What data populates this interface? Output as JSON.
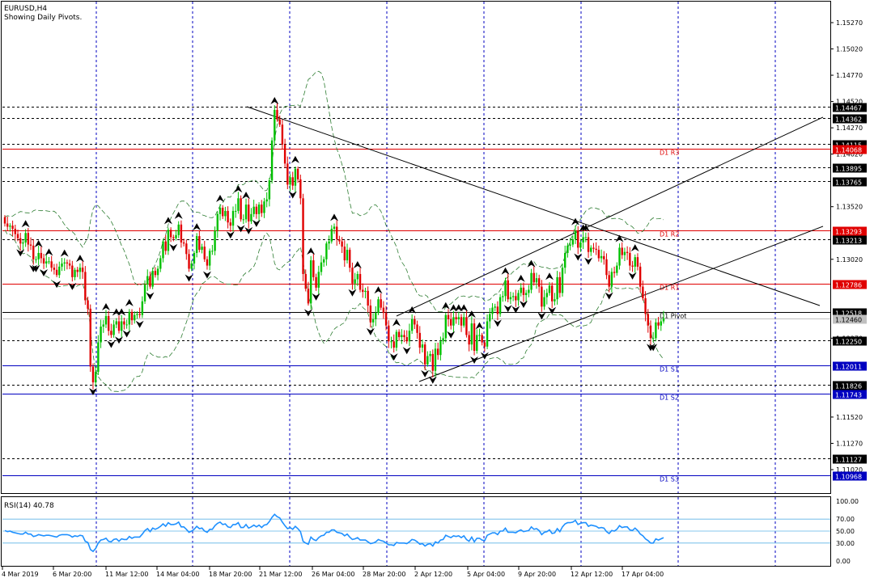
{
  "header": {
    "symbol_line": "EURUSD,H4",
    "subtitle": "Showing Daily Pivots."
  },
  "price_axis": {
    "ticks": [
      "1.15270",
      "1.15020",
      "1.14770",
      "1.14520",
      "1.14270",
      "1.14020",
      "1.13520",
      "1.13020",
      "1.12270",
      "1.11520",
      "1.11270",
      "1.11020"
    ]
  },
  "levels": [
    {
      "price": "1.14467",
      "style": "dash",
      "label": ""
    },
    {
      "price": "1.14362",
      "style": "dash",
      "label": ""
    },
    {
      "price": "1.14115",
      "style": "dash",
      "label": ""
    },
    {
      "price": "1.14068",
      "style": "red",
      "label": "D1 R3"
    },
    {
      "price": "1.13895",
      "style": "dash",
      "label": ""
    },
    {
      "price": "1.13765",
      "style": "dash",
      "label": ""
    },
    {
      "price": "1.13293",
      "style": "red",
      "label": "D1 R2"
    },
    {
      "price": "1.13213",
      "style": "dash",
      "label": ""
    },
    {
      "price": "1.12786",
      "style": "red",
      "label": "D1 R1"
    },
    {
      "price": "1.12518",
      "style": "black",
      "label": "D1 Pivot"
    },
    {
      "price": "1.12250",
      "style": "dash",
      "label": ""
    },
    {
      "price": "1.12011",
      "style": "blue",
      "label": "D1 S1"
    },
    {
      "price": "1.11826",
      "style": "dash",
      "label": ""
    },
    {
      "price": "1.11743",
      "style": "blue",
      "label": "D1 S2"
    },
    {
      "price": "1.11127",
      "style": "dash",
      "label": ""
    },
    {
      "price": "1.10968",
      "style": "blue",
      "label": "D1 S3"
    }
  ],
  "current_price": "1.12460",
  "rsi": {
    "label": "RSI(14) 40.78",
    "ticks": [
      "100.00",
      "70.00",
      "50.00",
      "30.00",
      "0.00"
    ]
  },
  "time_axis": [
    "4 Mar 2019",
    "6 Mar 20:00",
    "11 Mar 12:00",
    "14 Mar 04:00",
    "18 Mar 20:00",
    "21 Mar 12:00",
    "26 Mar 04:00",
    "28 Mar 20:00",
    "2 Apr 12:00",
    "5 Apr 04:00",
    "9 Apr 20:00",
    "12 Apr 12:00",
    "17 Apr 04:00"
  ],
  "colors": {
    "bull": "#00c000",
    "bear": "#e00000",
    "grid": "#0000c0",
    "pivot_red": "#e00000",
    "pivot_blue": "#0000c0",
    "rsi_line": "#1e90ff",
    "band": "#2e7d32",
    "bg": "#ffffff"
  },
  "chart_data": {
    "type": "candlestick",
    "xlabel": "",
    "ylabel": "",
    "ylim": [
      1.1087,
      1.1543
    ],
    "closes": [
      1.1336,
      1.1333,
      1.1334,
      1.1331,
      1.1326,
      1.1322,
      1.1317,
      1.1318,
      1.1327,
      1.1316,
      1.1315,
      1.1302,
      1.1302,
      1.1308,
      1.1303,
      1.1298,
      1.13,
      1.13,
      1.1294,
      1.1292,
      1.1287,
      1.1295,
      1.1298,
      1.1299,
      1.1298,
      1.1296,
      1.1285,
      1.1292,
      1.129,
      1.1294,
      1.129,
      1.1263,
      1.1255,
      1.12,
      1.1185,
      1.1195,
      1.1223,
      1.1238,
      1.124,
      1.1248,
      1.1234,
      1.123,
      1.124,
      1.1243,
      1.1234,
      1.1243,
      1.124,
      1.124,
      1.1252,
      1.1244,
      1.1249,
      1.125,
      1.1249,
      1.1262,
      1.1278,
      1.1286,
      1.1276,
      1.1291,
      1.1287,
      1.1293,
      1.1303,
      1.1319,
      1.131,
      1.133,
      1.1323,
      1.1322,
      1.1325,
      1.1335,
      1.1318,
      1.1317,
      1.1307,
      1.1293,
      1.1298,
      1.1308,
      1.1324,
      1.1311,
      1.1314,
      1.1302,
      1.1296,
      1.131,
      1.131,
      1.1329,
      1.1345,
      1.1351,
      1.1343,
      1.1348,
      1.1337,
      1.1334,
      1.1348,
      1.1348,
      1.136,
      1.134,
      1.134,
      1.1354,
      1.1338,
      1.1345,
      1.1352,
      1.1345,
      1.1354,
      1.1346,
      1.1357,
      1.1359,
      1.1377,
      1.1415,
      1.1444,
      1.1435,
      1.143,
      1.1411,
      1.1393,
      1.1373,
      1.138,
      1.1372,
      1.1388,
      1.1378,
      1.136,
      1.1288,
      1.1274,
      1.126,
      1.1301,
      1.1285,
      1.1275,
      1.129,
      1.1299,
      1.1302,
      1.1317,
      1.1319,
      1.1331,
      1.1333,
      1.1321,
      1.1319,
      1.1314,
      1.1301,
      1.1311,
      1.1294,
      1.1279,
      1.1283,
      1.1288,
      1.1273,
      1.1271,
      1.1272,
      1.1258,
      1.1242,
      1.1245,
      1.1251,
      1.1264,
      1.1256,
      1.1251,
      1.1239,
      1.1224,
      1.1224,
      1.1218,
      1.1233,
      1.1228,
      1.123,
      1.1228,
      1.1224,
      1.1234,
      1.1245,
      1.124,
      1.1232,
      1.1218,
      1.1221,
      1.1202,
      1.121,
      1.1212,
      1.1196,
      1.1217,
      1.1211,
      1.1224,
      1.1227,
      1.1249,
      1.1245,
      1.1239,
      1.1247,
      1.1245,
      1.1247,
      1.1239,
      1.1247,
      1.123,
      1.1221,
      1.1241,
      1.1215,
      1.123,
      1.123,
      1.1223,
      1.1219,
      1.1243,
      1.125,
      1.1256,
      1.1257,
      1.125,
      1.1266,
      1.1267,
      1.1282,
      1.1264,
      1.1266,
      1.1267,
      1.1263,
      1.127,
      1.1275,
      1.1268,
      1.127,
      1.1273,
      1.1289,
      1.128,
      1.1284,
      1.1276,
      1.1257,
      1.1266,
      1.127,
      1.1277,
      1.1262,
      1.1264,
      1.1285,
      1.127,
      1.1294,
      1.1308,
      1.1315,
      1.1316,
      1.1321,
      1.1329,
      1.1313,
      1.1318,
      1.1323,
      1.1323,
      1.1309,
      1.1313,
      1.1312,
      1.1311,
      1.1303,
      1.1305,
      1.1302,
      1.1287,
      1.1276,
      1.129,
      1.1289,
      1.1296,
      1.1313,
      1.1306,
      1.1309,
      1.1308,
      1.1296,
      1.1295,
      1.1304,
      1.1295,
      1.1276,
      1.1265,
      1.125,
      1.1239,
      1.1227,
      1.1227,
      1.1242,
      1.1239,
      1.1243,
      1.1246
    ],
    "rsi_values": [
      51,
      49,
      50,
      48,
      47,
      46,
      45,
      45,
      48,
      45,
      45,
      41,
      42,
      44,
      43,
      42,
      43,
      43,
      42,
      41,
      40,
      43,
      44,
      44,
      44,
      43,
      40,
      42,
      41,
      43,
      42,
      33,
      31,
      19,
      16,
      21,
      30,
      35,
      36,
      38,
      33,
      32,
      36,
      37,
      33,
      37,
      36,
      36,
      41,
      38,
      40,
      40,
      40,
      45,
      51,
      54,
      49,
      55,
      53,
      55,
      58,
      62,
      58,
      64,
      61,
      61,
      62,
      65,
      57,
      57,
      53,
      48,
      50,
      53,
      58,
      54,
      55,
      50,
      48,
      53,
      53,
      59,
      63,
      65,
      61,
      62,
      57,
      56,
      61,
      61,
      64,
      56,
      56,
      61,
      55,
      57,
      60,
      57,
      60,
      56,
      60,
      61,
      66,
      73,
      78,
      74,
      72,
      65,
      59,
      54,
      56,
      53,
      58,
      54,
      49,
      33,
      30,
      28,
      40,
      36,
      34,
      39,
      42,
      43,
      48,
      48,
      52,
      52,
      48,
      47,
      46,
      42,
      45,
      40,
      36,
      37,
      39,
      35,
      35,
      35,
      32,
      29,
      30,
      32,
      36,
      34,
      33,
      30,
      27,
      27,
      26,
      31,
      30,
      30,
      30,
      29,
      32,
      36,
      35,
      32,
      28,
      29,
      25,
      28,
      29,
      25,
      32,
      30,
      35,
      36,
      43,
      41,
      39,
      42,
      41,
      42,
      39,
      42,
      36,
      33,
      40,
      32,
      38,
      38,
      35,
      34,
      43,
      45,
      47,
      47,
      44,
      50,
      50,
      55,
      48,
      48,
      48,
      47,
      50,
      52,
      49,
      50,
      51,
      57,
      53,
      54,
      51,
      44,
      48,
      49,
      52,
      46,
      47,
      54,
      49,
      57,
      62,
      64,
      64,
      65,
      68,
      61,
      63,
      64,
      64,
      58,
      60,
      59,
      58,
      55,
      56,
      55,
      49,
      46,
      51,
      50,
      53,
      59,
      56,
      57,
      57,
      52,
      51,
      55,
      51,
      45,
      42,
      37,
      34,
      30,
      30,
      37,
      35,
      37,
      39
    ]
  }
}
